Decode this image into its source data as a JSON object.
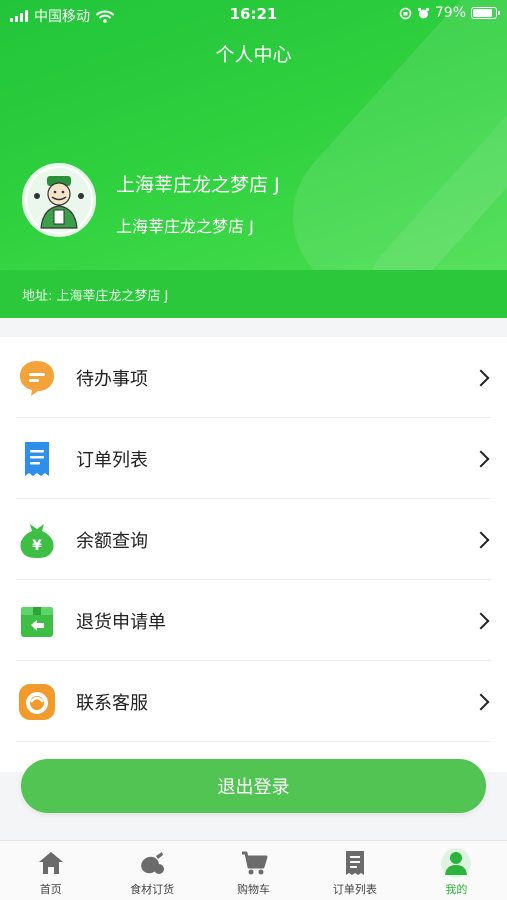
{
  "status": {
    "carrier": "中国移动",
    "time": "16:21",
    "battery": "79%"
  },
  "header": {
    "title": "个人中心"
  },
  "profile": {
    "store_name": "上海莘庄龙之梦店 J",
    "store_sub": "上海莘庄龙之梦店 J",
    "address_label": "地址:",
    "address_value": "上海莘庄龙之梦店 J"
  },
  "menu": {
    "items": [
      {
        "label": "待办事项",
        "icon": "todo-icon"
      },
      {
        "label": "订单列表",
        "icon": "order-list-icon"
      },
      {
        "label": "余额查询",
        "icon": "balance-icon"
      },
      {
        "label": "退货申请单",
        "icon": "return-icon"
      },
      {
        "label": "联系客服",
        "icon": "customer-service-icon"
      }
    ]
  },
  "logout": {
    "label": "退出登录"
  },
  "tabbar": {
    "active_index": 4,
    "tabs": [
      {
        "label": "首页",
        "icon": "home-icon"
      },
      {
        "label": "食材订货",
        "icon": "ingredients-icon"
      },
      {
        "label": "购物车",
        "icon": "cart-icon"
      },
      {
        "label": "订单列表",
        "icon": "receipt-icon"
      },
      {
        "label": "我的",
        "icon": "user-icon"
      }
    ]
  },
  "colors": {
    "brand_green": "#2bc83c",
    "button_green": "#52c454",
    "active_tab": "#2bb43b"
  }
}
